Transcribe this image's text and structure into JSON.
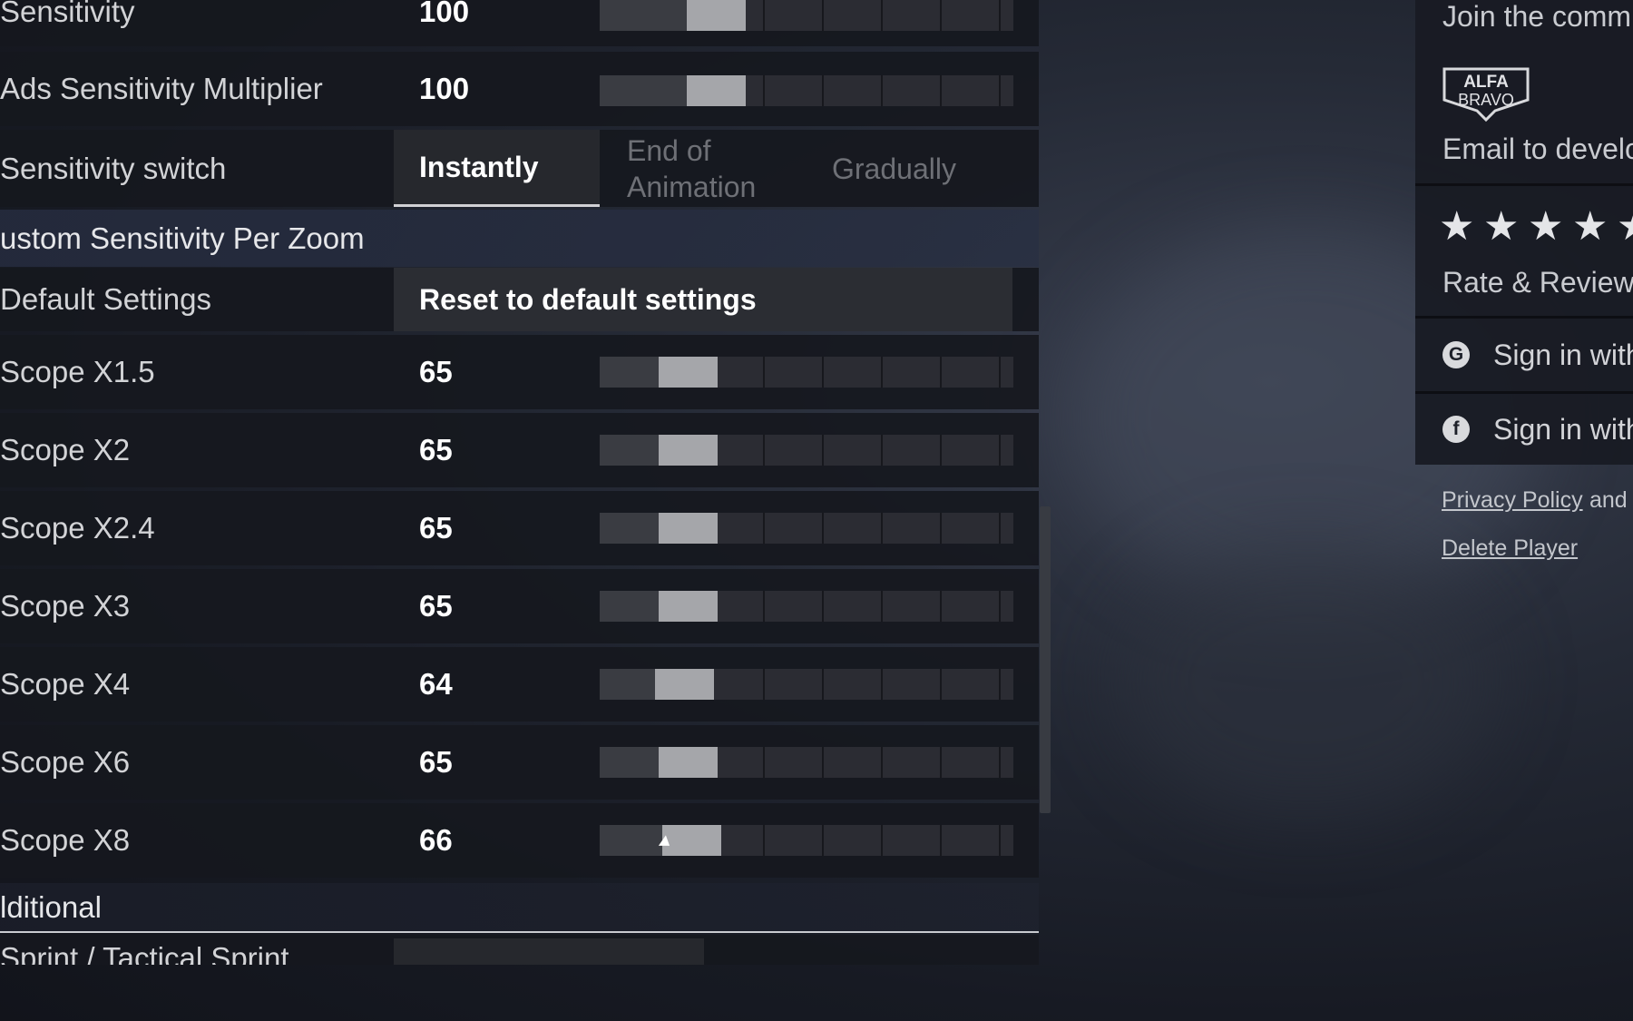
{
  "sensitivity_rows": [
    {
      "label": "Sensitivity",
      "value": "100",
      "level": 0.22
    },
    {
      "label": "Ads Sensitivity Multiplier",
      "value": "100",
      "level": 0.22
    }
  ],
  "sensitivity_switch": {
    "label": "Sensitivity switch",
    "options": [
      "Instantly",
      "End of Animation",
      "Gradually"
    ],
    "selected": "Instantly"
  },
  "custom_section": {
    "title": "ustom Sensitivity Per Zoom"
  },
  "default_settings": {
    "label": "Default Settings",
    "button": "Reset to default settings"
  },
  "scope_rows": [
    {
      "label": "Scope X1.5",
      "value": "65",
      "level": 0.14
    },
    {
      "label": "Scope X2",
      "value": "65",
      "level": 0.14
    },
    {
      "label": "Scope X2.4",
      "value": "65",
      "level": 0.14
    },
    {
      "label": "Scope X3",
      "value": "65",
      "level": 0.14
    },
    {
      "label": "Scope X4",
      "value": "64",
      "level": 0.13
    },
    {
      "label": "Scope X6",
      "value": "65",
      "level": 0.14
    },
    {
      "label": "Scope X8",
      "value": "66",
      "level": 0.15
    }
  ],
  "additional_section": {
    "title": "lditional"
  },
  "sprint_row": {
    "label": "Sprint / Tactical Sprint"
  },
  "sidebar": {
    "community": "Join the comm",
    "logo": {
      "line1": "ALFA",
      "line2": "BRAVO"
    },
    "email": "Email to develo",
    "stars": [
      "★",
      "★",
      "★",
      "★",
      "★"
    ],
    "rate": "Rate & Review",
    "google_signin": "Sign in with",
    "facebook_signin": "Sign in with",
    "google_icon": "G",
    "facebook_icon": "f",
    "privacy": "Privacy Policy",
    "and": "and",
    "delete": "Delete Player"
  },
  "colors": {
    "thumb": "#a5a6aa",
    "track": "#2d2f35",
    "accent": "#ffffff",
    "section_bg": "#2a3044"
  }
}
